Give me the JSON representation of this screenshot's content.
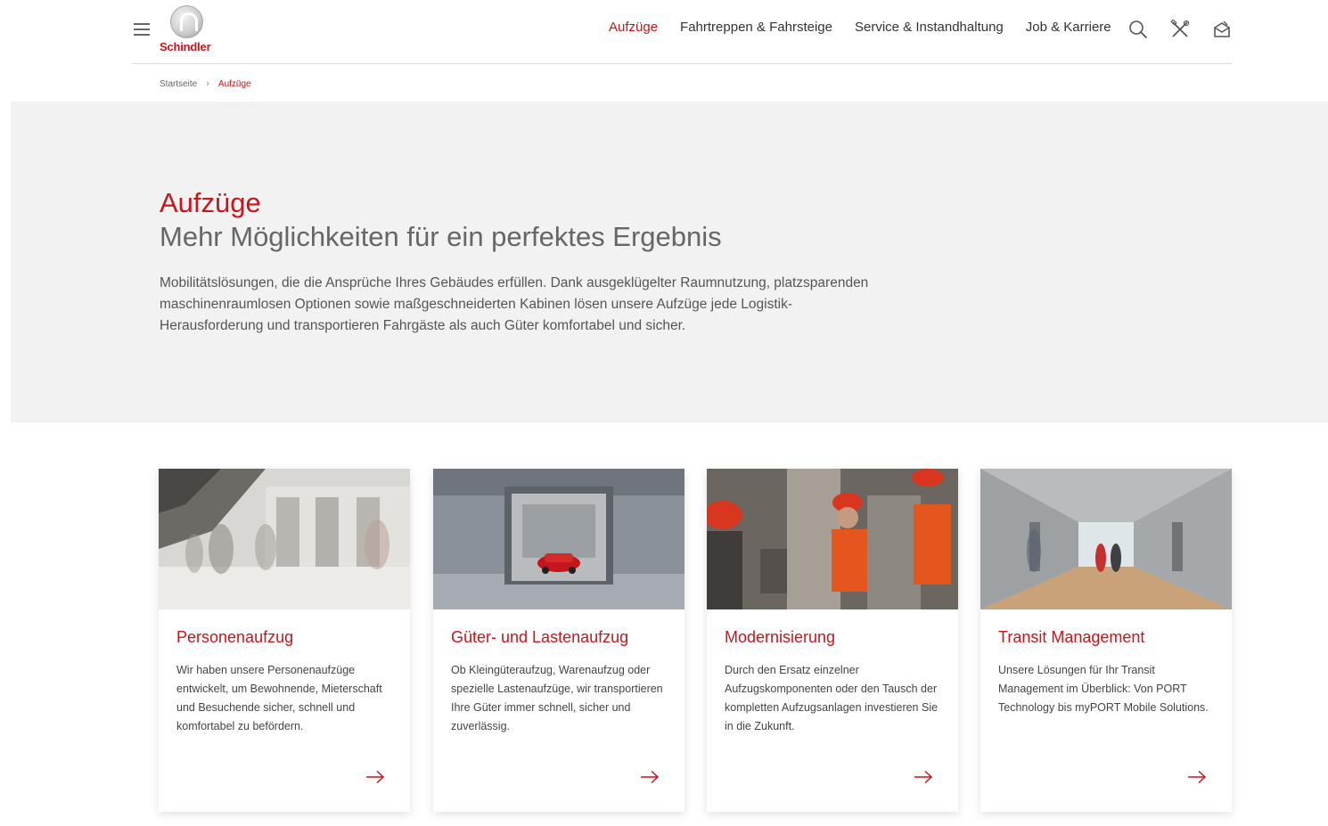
{
  "header": {
    "brand": "Schindler",
    "nav": [
      {
        "label": "Aufzüge",
        "active": true
      },
      {
        "label": "Fahrtreppen & Fahrsteige",
        "active": false
      },
      {
        "label": "Service & Instandhaltung",
        "active": false
      },
      {
        "label": "Job & Karriere",
        "active": false
      }
    ],
    "icons": [
      "menu-icon",
      "search-icon",
      "tools-icon",
      "contact-icon"
    ]
  },
  "breadcrumb": {
    "home": "Startseite",
    "separator": "›",
    "current": "Aufzüge"
  },
  "hero": {
    "title": "Aufzüge",
    "subtitle": "Mehr Möglichkeiten für ein perfektes Ergebnis",
    "text": "Mobilitätslösungen, die die Ansprüche Ihres Gebäudes erfüllen. Dank ausgeklügelter Raumnutzung, platzsparenden maschinenraumlosen Optionen sowie maßgeschneiderten Kabinen lösen unsere Aufzüge jede Logistik-Herausforderung und transportieren Fahrgäste als auch Güter komfortabel und sicher."
  },
  "cards": [
    {
      "title": "Personenaufzug",
      "text": "Wir haben unsere Personenaufzüge entwickelt, um Bewohnende, Mieterschaft und Besuchende sicher, schnell und komfortabel zu befördern.",
      "icon": "arrow-right-icon"
    },
    {
      "title": "Güter- und Lastenaufzug",
      "text": "Ob Kleingüteraufzug, Warenaufzug oder spezielle Lastenaufzüge, wir transportieren Ihre Güter immer schnell, sicher und zuverlässig.",
      "icon": "arrow-right-icon"
    },
    {
      "title": "Modernisierung",
      "text": "Durch den Ersatz einzelner Aufzugskomponenten oder den Tausch der kompletten Aufzugsanlagen investieren Sie in die Zukunft.",
      "icon": "arrow-right-icon"
    },
    {
      "title": "Transit Management",
      "text": "Unsere Lösungen für Ihr Transit Management im Überblick: Von PORT Technology bis myPORT Mobile Solutions.",
      "icon": "arrow-right-icon"
    }
  ],
  "colors": {
    "brand_red": "#c4161c",
    "hero_bg": "#f2f2f2",
    "text": "#333333"
  }
}
